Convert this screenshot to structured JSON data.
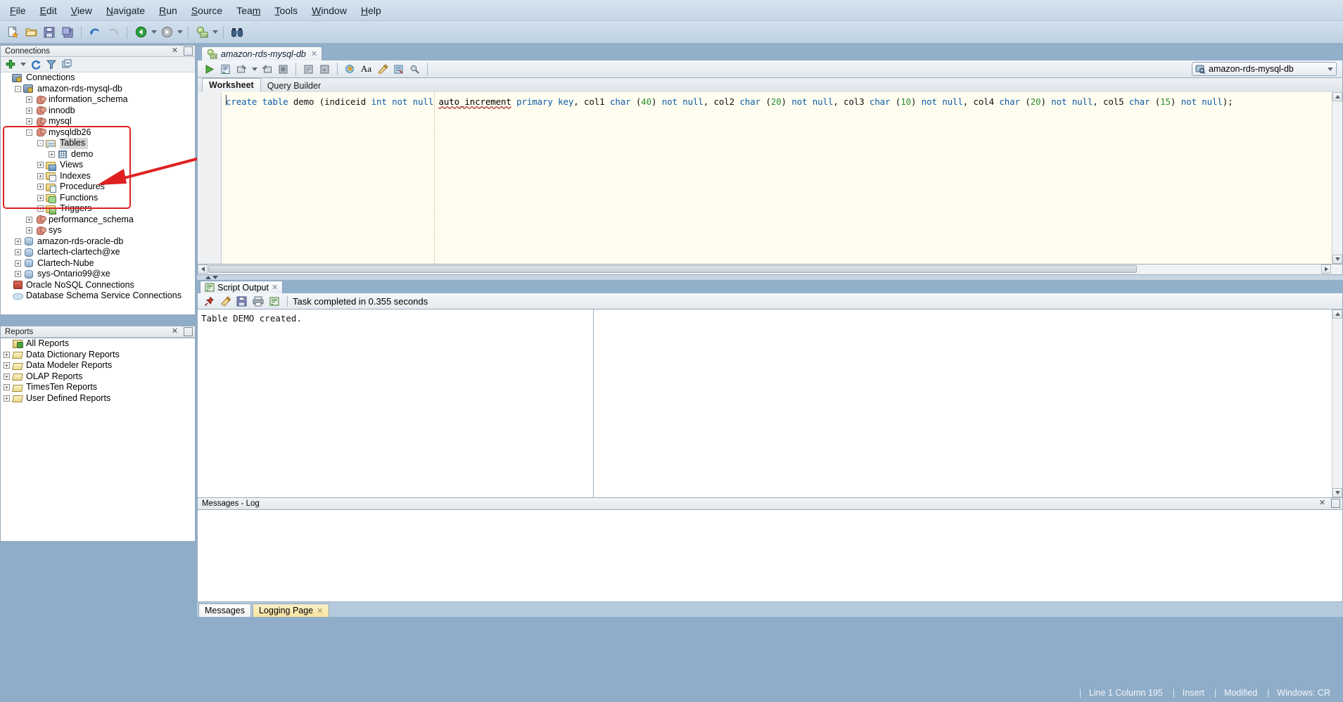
{
  "menu": {
    "items": [
      {
        "label": "File",
        "accel": "F"
      },
      {
        "label": "Edit",
        "accel": "E"
      },
      {
        "label": "View",
        "accel": "V"
      },
      {
        "label": "Navigate",
        "accel": "N"
      },
      {
        "label": "Run",
        "accel": "R"
      },
      {
        "label": "Source",
        "accel": "S"
      },
      {
        "label": "Team",
        "accel": "m"
      },
      {
        "label": "Tools",
        "accel": "T"
      },
      {
        "label": "Window",
        "accel": "W"
      },
      {
        "label": "Help",
        "accel": "H"
      }
    ]
  },
  "main_toolbar": {
    "buttons": [
      {
        "name": "new-file-icon",
        "title": "New"
      },
      {
        "name": "open-folder-icon",
        "title": "Open"
      },
      {
        "name": "save-icon",
        "title": "Save"
      },
      {
        "name": "save-all-icon",
        "title": "Save All"
      },
      {
        "name": "undo-icon",
        "title": "Undo"
      },
      {
        "name": "redo-icon",
        "title": "Redo"
      },
      {
        "name": "back-arrow-icon",
        "title": "Back"
      },
      {
        "name": "forward-arrow-icon",
        "title": "Forward"
      },
      {
        "name": "sql-worksheet-icon",
        "title": "SQL Worksheet"
      },
      {
        "name": "binoculars-search-icon",
        "title": "Find"
      }
    ]
  },
  "connections_panel": {
    "title": "Connections",
    "toolbar": [
      {
        "name": "add-connection-icon",
        "title": "New Connection"
      },
      {
        "name": "dropdown-caret-icon",
        "title": "More"
      },
      {
        "name": "refresh-icon",
        "title": "Refresh"
      },
      {
        "name": "filter-icon",
        "title": "Filter"
      },
      {
        "name": "collapse-all-icon",
        "title": "Collapse All"
      }
    ],
    "tree": [
      {
        "label": "Connections",
        "icon": "connections-icon",
        "indent": 0,
        "exp": "none",
        "selected": false
      },
      {
        "label": "amazon-rds-mysql-db",
        "icon": "connections-icon",
        "indent": 1,
        "exp": "-",
        "selected": false
      },
      {
        "label": "information_schema",
        "icon": "user-icon",
        "indent": 2,
        "exp": "+",
        "selected": false
      },
      {
        "label": "innodb",
        "icon": "user-icon",
        "indent": 2,
        "exp": "+",
        "selected": false
      },
      {
        "label": "mysql",
        "icon": "user-icon",
        "indent": 2,
        "exp": "+",
        "selected": false
      },
      {
        "label": "mysqldb26",
        "icon": "user-icon",
        "indent": 2,
        "exp": "-",
        "selected": false
      },
      {
        "label": "Tables",
        "icon": "tables-folder-icon",
        "indent": 3,
        "exp": "-",
        "selected": true
      },
      {
        "label": "demo",
        "icon": "table-grid-icon",
        "indent": 4,
        "exp": "+",
        "selected": false
      },
      {
        "label": "Views",
        "icon": "views-folder-icon",
        "indent": 3,
        "exp": "+",
        "selected": false
      },
      {
        "label": "Indexes",
        "icon": "indexes-folder-icon",
        "indent": 3,
        "exp": "+",
        "selected": false
      },
      {
        "label": "Procedures",
        "icon": "procedures-folder-icon",
        "indent": 3,
        "exp": "+",
        "selected": false
      },
      {
        "label": "Functions",
        "icon": "functions-folder-icon",
        "indent": 3,
        "exp": "+",
        "selected": false
      },
      {
        "label": "Triggers",
        "icon": "triggers-folder-icon",
        "indent": 3,
        "exp": "+",
        "selected": false
      },
      {
        "label": "performance_schema",
        "icon": "user-icon",
        "indent": 2,
        "exp": "+",
        "selected": false
      },
      {
        "label": "sys",
        "icon": "user-icon",
        "indent": 2,
        "exp": "+",
        "selected": false
      },
      {
        "label": "amazon-rds-oracle-db",
        "icon": "database-icon",
        "indent": 1,
        "exp": "+",
        "selected": false
      },
      {
        "label": "clartech-clartech@xe",
        "icon": "database-icon",
        "indent": 1,
        "exp": "+",
        "selected": false
      },
      {
        "label": "Clartech-Nube",
        "icon": "database-icon",
        "indent": 1,
        "exp": "+",
        "selected": false
      },
      {
        "label": "sys-Ontario99@xe",
        "icon": "database-icon",
        "indent": 1,
        "exp": "+",
        "selected": false
      },
      {
        "label": "Oracle NoSQL Connections",
        "icon": "nosql-icon",
        "indent": 0,
        "exp": "none",
        "selected": false
      },
      {
        "label": "Database Schema Service Connections",
        "icon": "cloud-icon",
        "indent": 0,
        "exp": "none",
        "selected": false
      }
    ]
  },
  "reports_panel": {
    "title": "Reports",
    "tree": [
      {
        "label": "All Reports",
        "icon": "all-reports-icon",
        "indent": 0,
        "exp": "none"
      },
      {
        "label": "Data Dictionary Reports",
        "icon": "report-folder-icon",
        "indent": 0,
        "exp": "+"
      },
      {
        "label": "Data Modeler Reports",
        "icon": "report-folder-icon",
        "indent": 0,
        "exp": "+"
      },
      {
        "label": "OLAP Reports",
        "icon": "report-folder-icon",
        "indent": 0,
        "exp": "+"
      },
      {
        "label": "TimesTen Reports",
        "icon": "report-folder-icon",
        "indent": 0,
        "exp": "+"
      },
      {
        "label": "User Defined Reports",
        "icon": "report-folder-icon",
        "indent": 0,
        "exp": "+"
      }
    ]
  },
  "editor": {
    "document_tab": "amazon-rds-mysql-db",
    "toolbar": [
      {
        "name": "run-statement-icon",
        "title": "Run Statement"
      },
      {
        "name": "run-script-icon",
        "title": "Run Script"
      },
      {
        "name": "commit-icon",
        "title": "Commit"
      },
      {
        "name": "rollback-icon",
        "title": "Rollback"
      },
      {
        "name": "cancel-icon",
        "title": "Cancel"
      },
      {
        "name": "sql-history-icon",
        "title": "SQL History"
      },
      {
        "name": "explain-plan-icon",
        "title": "Explain Plan"
      },
      {
        "name": "autotrace-icon",
        "title": "Autotrace"
      },
      {
        "name": "format-icon",
        "title": "Format"
      },
      {
        "name": "clear-icon",
        "title": "Clear"
      }
    ],
    "connection_selector": "amazon-rds-mysql-db",
    "tabs": [
      {
        "label": "Worksheet",
        "active": true
      },
      {
        "label": "Query Builder",
        "active": false
      }
    ],
    "sql": {
      "full_text": "create table demo (indiceid int not null auto_increment primary key, col1 char (40) not null, col2 char (20) not null, col3 char (10) not null, col4 char (20) not null, col5 char (15) not null);",
      "tokens": [
        {
          "t": "create ",
          "c": "k"
        },
        {
          "t": "table ",
          "c": "k"
        },
        {
          "t": "demo ",
          "c": "pl"
        },
        {
          "t": "(indiceid ",
          "c": "pl"
        },
        {
          "t": "int ",
          "c": "k"
        },
        {
          "t": "not ",
          "c": "k"
        },
        {
          "t": "null ",
          "c": "k"
        },
        {
          "t": "auto_increment",
          "c": "sq"
        },
        {
          "t": " ",
          "c": "pl"
        },
        {
          "t": "primary ",
          "c": "k"
        },
        {
          "t": "key",
          "c": "k"
        },
        {
          "t": ", col1 ",
          "c": "pl"
        },
        {
          "t": "char ",
          "c": "k"
        },
        {
          "t": "(",
          "c": "pl"
        },
        {
          "t": "40",
          "c": "num"
        },
        {
          "t": ") ",
          "c": "pl"
        },
        {
          "t": "not ",
          "c": "k"
        },
        {
          "t": "null",
          "c": "k"
        },
        {
          "t": ", col2 ",
          "c": "pl"
        },
        {
          "t": "char ",
          "c": "k"
        },
        {
          "t": "(",
          "c": "pl"
        },
        {
          "t": "20",
          "c": "num"
        },
        {
          "t": ") ",
          "c": "pl"
        },
        {
          "t": "not ",
          "c": "k"
        },
        {
          "t": "null",
          "c": "k"
        },
        {
          "t": ", col3 ",
          "c": "pl"
        },
        {
          "t": "char ",
          "c": "k"
        },
        {
          "t": "(",
          "c": "pl"
        },
        {
          "t": "10",
          "c": "num"
        },
        {
          "t": ") ",
          "c": "pl"
        },
        {
          "t": "not ",
          "c": "k"
        },
        {
          "t": "null",
          "c": "k"
        },
        {
          "t": ", col4 ",
          "c": "pl"
        },
        {
          "t": "char ",
          "c": "k"
        },
        {
          "t": "(",
          "c": "pl"
        },
        {
          "t": "20",
          "c": "num"
        },
        {
          "t": ") ",
          "c": "pl"
        },
        {
          "t": "not ",
          "c": "k"
        },
        {
          "t": "null",
          "c": "k"
        },
        {
          "t": ", col5 ",
          "c": "pl"
        },
        {
          "t": "char ",
          "c": "k"
        },
        {
          "t": "(",
          "c": "pl"
        },
        {
          "t": "15",
          "c": "num"
        },
        {
          "t": ") ",
          "c": "pl"
        },
        {
          "t": "not ",
          "c": "k"
        },
        {
          "t": "null",
          "c": "k"
        },
        {
          "t": ");",
          "c": "pl"
        }
      ]
    }
  },
  "script_output": {
    "tab_label": "Script Output",
    "toolbar": [
      {
        "name": "pin-icon",
        "title": "Pin"
      },
      {
        "name": "eraser-clear-icon",
        "title": "Clear"
      },
      {
        "name": "save-output-icon",
        "title": "Save"
      },
      {
        "name": "print-icon",
        "title": "Print"
      },
      {
        "name": "wrap-output-icon",
        "title": "Wrap"
      }
    ],
    "status": "Task completed in 0.355 seconds",
    "body_text": "Table DEMO created."
  },
  "messages_log": {
    "title": "Messages - Log",
    "tabs": [
      {
        "label": "Messages",
        "closable": false,
        "active": false
      },
      {
        "label": "Logging Page",
        "closable": true,
        "active": true
      }
    ]
  },
  "statusbar": {
    "items": [
      "Line 1 Column 195",
      "Insert",
      "Modified",
      "Windows: CR"
    ]
  },
  "annotation": {
    "highlight_color": "#e02020",
    "note": "red rectangle around mysqldb26 node and arrow pointing to demo table"
  }
}
